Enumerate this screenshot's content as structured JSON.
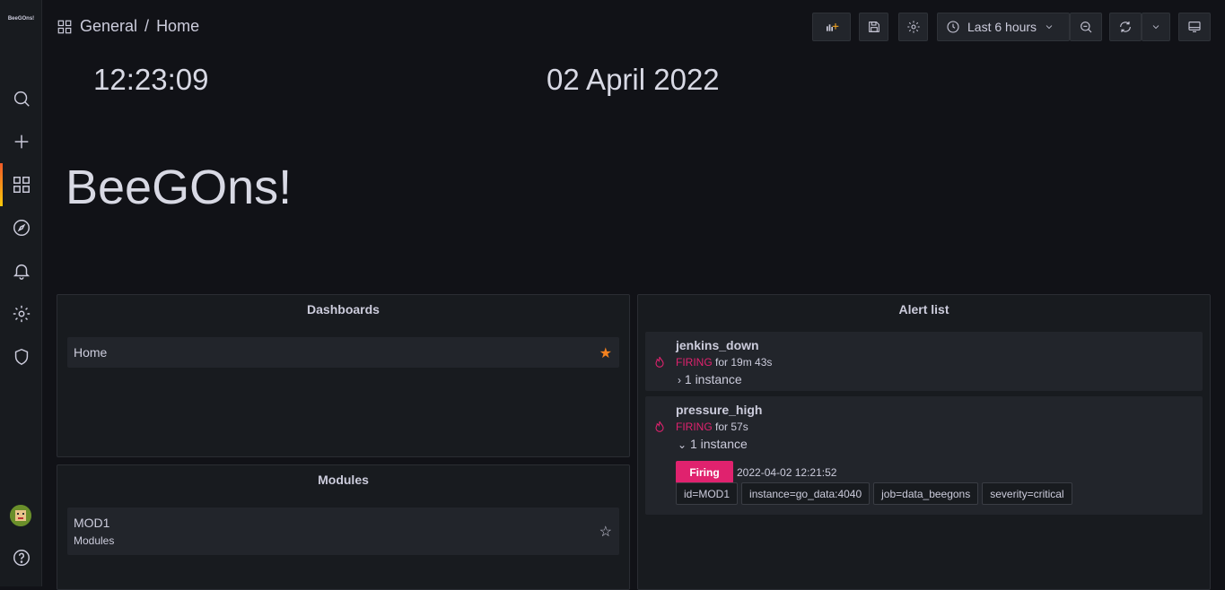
{
  "app": {
    "logo_text": "BeeGOns!"
  },
  "breadcrumb": {
    "folder": "General",
    "separator": "/",
    "page": "Home"
  },
  "toolbar": {
    "time_range": "Last 6 hours"
  },
  "clock": {
    "time": "12:23:09",
    "date": "02 April 2022"
  },
  "hero": {
    "title": "BeeGOns!"
  },
  "dashboards_panel": {
    "title": "Dashboards",
    "items": [
      {
        "name": "Home",
        "starred": true
      }
    ]
  },
  "modules_panel": {
    "title": "Modules",
    "items": [
      {
        "name": "MOD1",
        "folder": "Modules",
        "starred": false
      }
    ]
  },
  "alert_panel": {
    "title": "Alert list",
    "alerts": [
      {
        "name": "jenkins_down",
        "state": "FIRING",
        "duration": "for 19m 43s",
        "instances": "1 instance",
        "expanded": false
      },
      {
        "name": "pressure_high",
        "state": "FIRING",
        "duration": "for 57s",
        "instances": "1 instance",
        "expanded": true,
        "instance_state": "Firing",
        "instance_time": "2022-04-02 12:21:52",
        "labels": [
          "id=MOD1",
          "instance=go_data:4040",
          "job=data_beegons",
          "severity=critical"
        ]
      }
    ]
  },
  "colors": {
    "firing": "#e0226e",
    "star": "#f5821f"
  }
}
